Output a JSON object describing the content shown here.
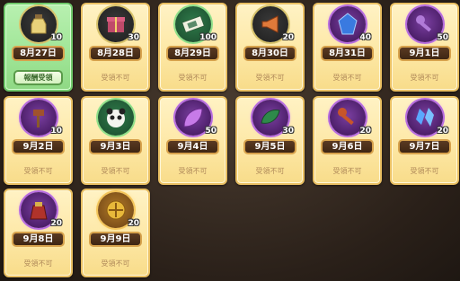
{
  "cards": [
    {
      "date": "8月27日",
      "qty": "10",
      "icon": "potion-bottle-icon",
      "status": "報酬受領",
      "claimable": true
    },
    {
      "date": "8月28日",
      "qty": "30",
      "icon": "gift-box-icon",
      "status": "受領不可",
      "claimable": false
    },
    {
      "date": "8月29日",
      "qty": "100",
      "icon": "ticket-icon",
      "status": "受領不可",
      "claimable": false
    },
    {
      "date": "8月30日",
      "qty": "20",
      "icon": "megaphone-icon",
      "status": "受領不可",
      "claimable": false
    },
    {
      "date": "8月31日",
      "qty": "40",
      "icon": "blue-crystal-icon",
      "status": "受領不可",
      "claimable": false
    },
    {
      "date": "9月1日",
      "qty": "50",
      "icon": "purple-key-icon",
      "status": "受領不可",
      "claimable": false
    },
    {
      "date": "9月2日",
      "qty": "10",
      "icon": "brown-axe-icon",
      "status": "受領不可",
      "claimable": false
    },
    {
      "date": "9月3日",
      "qty": "",
      "icon": "panda-character-icon",
      "status": "受領不可",
      "claimable": false
    },
    {
      "date": "9月4日",
      "qty": "50",
      "icon": "purple-leaf-icon",
      "status": "受領不可",
      "claimable": false
    },
    {
      "date": "9月5日",
      "qty": "30",
      "icon": "green-leaf-icon",
      "status": "受領不可",
      "claimable": false
    },
    {
      "date": "9月6日",
      "qty": "20",
      "icon": "red-key-icon",
      "status": "受領不可",
      "claimable": false
    },
    {
      "date": "9月7日",
      "qty": "20",
      "icon": "blue-crystals-icon",
      "status": "受領不可",
      "claimable": false
    },
    {
      "date": "9月8日",
      "qty": "20",
      "icon": "red-pouch-icon",
      "status": "受領不可",
      "claimable": false
    },
    {
      "date": "9月9日",
      "qty": "20",
      "icon": "gold-emblem-icon",
      "status": "受領不可",
      "claimable": false
    }
  ],
  "colors": {
    "card_bg": "#fde8a6",
    "card_active_bg": "#9fe596",
    "date_bg": "#3e2613",
    "status_text": "#b08a5a"
  }
}
